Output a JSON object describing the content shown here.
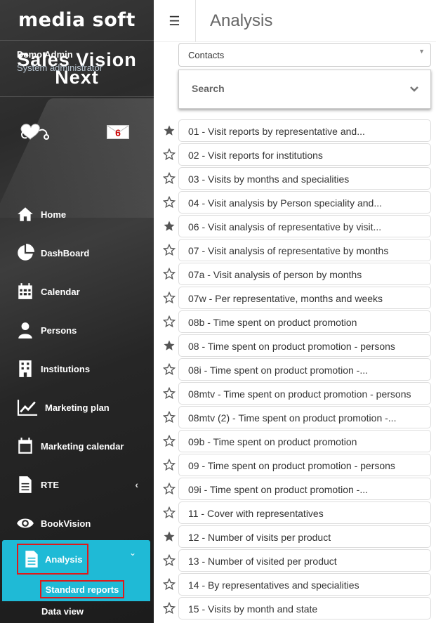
{
  "sidebar": {
    "logo": "media soft",
    "brand_line1": "Sales Vision",
    "brand_line2": "Next",
    "user": {
      "name": "Demo Admin",
      "role": "System administrator",
      "unread_messages": "6"
    },
    "nav": [
      {
        "label": "Home",
        "icon": "home-icon"
      },
      {
        "label": "DashBoard",
        "icon": "pie-chart-icon"
      },
      {
        "label": "Calendar",
        "icon": "calendar-grid-icon"
      },
      {
        "label": "Persons",
        "icon": "person-icon"
      },
      {
        "label": "Institutions",
        "icon": "building-icon"
      },
      {
        "label": "Marketing plan",
        "icon": "line-chart-icon"
      },
      {
        "label": "Marketing calendar",
        "icon": "calendar-icon"
      },
      {
        "label": "RTE",
        "icon": "document-icon"
      },
      {
        "label": "BookVision",
        "icon": "eye-icon"
      }
    ],
    "active_section": {
      "label": "Analysis",
      "icon": "document-icon"
    },
    "submenu": [
      {
        "label": "Standard reports",
        "active": true
      },
      {
        "label": "Data view",
        "active": false
      }
    ],
    "accent_color": "#1fbad6",
    "highlight_color": "#e01919"
  },
  "header": {
    "title": "Analysis",
    "menu_icon": "hamburger-icon"
  },
  "filters": {
    "contacts_value": "Contacts",
    "search_label": "Search"
  },
  "reports": [
    {
      "label": "01 - Visit reports by representative and...",
      "favorite": true
    },
    {
      "label": "02 - Visit reports for institutions",
      "favorite": false
    },
    {
      "label": "03 - Visits by months and specialities",
      "favorite": false
    },
    {
      "label": "04 - Visit analysis by Person speciality and...",
      "favorite": false
    },
    {
      "label": "06 - Visit analysis of representative by visit...",
      "favorite": true
    },
    {
      "label": "07 - Visit analysis of representative by months",
      "favorite": false
    },
    {
      "label": "07a - Visit analysis of person by months",
      "favorite": false
    },
    {
      "label": "07w - Per representative, months and weeks",
      "favorite": false
    },
    {
      "label": "08b - Time spent on product promotion",
      "favorite": false
    },
    {
      "label": "08 - Time spent on product promotion - persons",
      "favorite": true
    },
    {
      "label": "08i - Time spent on product promotion -...",
      "favorite": false
    },
    {
      "label": "08mtv - Time spent on product promotion - persons",
      "favorite": false
    },
    {
      "label": "08mtv (2) - Time spent on product promotion -...",
      "favorite": false
    },
    {
      "label": "09b - Time spent on product promotion",
      "favorite": false
    },
    {
      "label": "09 - Time spent on product promotion - persons",
      "favorite": false
    },
    {
      "label": "09i - Time spent on product promotion -...",
      "favorite": false
    },
    {
      "label": "11 - Cover with representatives",
      "favorite": false
    },
    {
      "label": "12 - Number of visits per product",
      "favorite": true
    },
    {
      "label": "13 - Number of visited per product",
      "favorite": false
    },
    {
      "label": "14 - By representatives and specialities",
      "favorite": false
    },
    {
      "label": "15 - Visits by month and state",
      "favorite": false
    }
  ]
}
